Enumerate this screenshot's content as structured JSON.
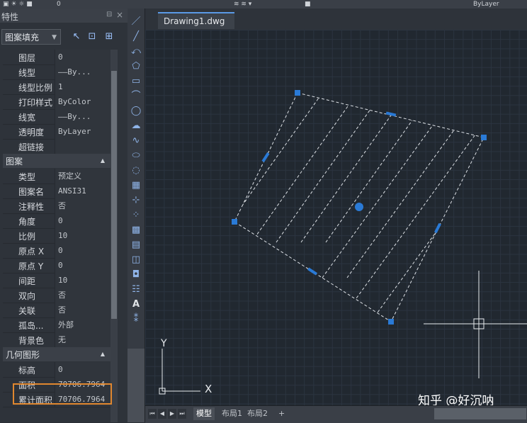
{
  "top": {
    "value": "0",
    "linetype": "ByLayer"
  },
  "panel": {
    "title": "特性",
    "selector": "图案填充",
    "rows_general": [
      {
        "label": "图层",
        "value": "0"
      },
      {
        "label": "线型",
        "value": "——By..."
      },
      {
        "label": "线型比例",
        "value": "1"
      },
      {
        "label": "打印样式",
        "value": "ByColor"
      },
      {
        "label": "线宽",
        "value": "——By..."
      },
      {
        "label": "透明度",
        "value": "ByLayer"
      },
      {
        "label": "超链接",
        "value": ""
      }
    ],
    "cat_pattern": "图案",
    "rows_pattern": [
      {
        "label": "类型",
        "value": "预定义"
      },
      {
        "label": "图案名",
        "value": "ANSI31"
      },
      {
        "label": "注释性",
        "value": "否"
      },
      {
        "label": "角度",
        "value": "0"
      },
      {
        "label": "比例",
        "value": "10"
      },
      {
        "label": "原点 X",
        "value": "0"
      },
      {
        "label": "原点 Y",
        "value": "0"
      },
      {
        "label": "间距",
        "value": "10"
      },
      {
        "label": "双向",
        "value": "否"
      },
      {
        "label": "关联",
        "value": "否"
      },
      {
        "label": "孤岛...",
        "value": "外部"
      },
      {
        "label": "背景色",
        "value": "无"
      }
    ],
    "cat_geometry": "几何图形",
    "rows_geometry": [
      {
        "label": "标高",
        "value": "0"
      },
      {
        "label": "面积",
        "value": "70706.7964"
      },
      {
        "label": "累计面积",
        "value": "70706.7964"
      }
    ]
  },
  "document": {
    "tab": "Drawing1.dwg"
  },
  "ucs": {
    "y": "Y",
    "x": "X"
  },
  "layout_tabs": [
    "模型",
    "布局1",
    "布局2",
    "+"
  ],
  "watermark": "知乎 @好沉呐",
  "colors": {
    "grip": "#2a7ad6",
    "highlight": "#e0872f",
    "canvas": "#212830"
  }
}
